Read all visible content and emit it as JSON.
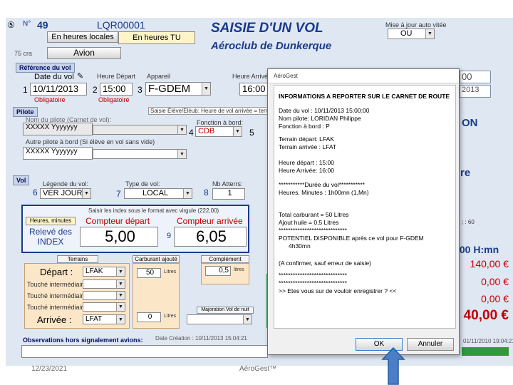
{
  "header": {
    "corner_glyph": "⑤",
    "num_label": "N°",
    "num_value": "49",
    "record_code": "LQR00001",
    "title": "SAISIE D'UN VOL",
    "subtitle": "Aéroclub de Dunkerque",
    "btn_heures_locales": "En heures locales",
    "btn_heures_tu": "En heures TU",
    "btn_avion": "Avion",
    "side_text": "75 cra",
    "mise_label": "Mise à jour auto vitée",
    "mise_value": "OU"
  },
  "reference": {
    "section": "Référence du vol",
    "date_label": "Date du vol",
    "date_value": "10/11/2013",
    "date_sub": "Obligatoire",
    "heure_label": "Heure Départ",
    "heure_value": "15:00",
    "heure_sub": "Obligatoire",
    "appareil_label": "Appareil",
    "appareil_value": "F-GDEM",
    "arrivee_label": "Heure Arrivée",
    "arrivee_value": "16:00",
    "num1": "1",
    "num2": "2",
    "num3": "3",
    "right_box1": "00",
    "right_box2": "2013"
  },
  "pilote": {
    "section": "Pilote",
    "saisie_note": "Saisie Élève/Elèub: Heure de vol arrivée = temps",
    "nom_label": "Nom du pilote (Carnet de vol):",
    "nom_value": "XXXXX Yyyyyyy",
    "fonction_label": "Fonction à bord:",
    "fonction_value": "CDB",
    "num4": "4",
    "num5": "5",
    "instr_label": "Autre pilote à bord (Si élève en vol sans vide)",
    "instr_value": "XXXXX Yyyyyyy",
    "right_on": "ON",
    "right_re": "re"
  },
  "vol": {
    "section": "Vol",
    "legende_label": "Légende du vol:",
    "legende_value": "VER JOUR",
    "type_label": "Type de vol:",
    "type_value": "LOCAL",
    "att_label": "Nb Atterrs:",
    "att_value": "1",
    "num6": "6",
    "num7": "7",
    "num8": "8",
    "right_60": "; : 60"
  },
  "compteurs": {
    "instruction": "Saisir les index sous le format avec virgule (222,00)",
    "heures_btn": "Heures, minutes",
    "depart_label": "Compteur départ",
    "arrivee_label": "Compteur arrivée",
    "releve": "Relevé des INDEX",
    "depart_value": "5,00",
    "arrivee_value": "6,05",
    "num9": "9",
    "right_hmm": ",00 H:mn"
  },
  "terrains": {
    "terrains_label": "Terrains",
    "carburant_label": "Carburant ajouté",
    "complement_label": "Complément d'huile",
    "depart_label": "Départ :",
    "depart_value": "LFAK",
    "t1_label": "Touché intermédiaire:",
    "t2_label": "Touché intermédiaire:",
    "t3_label": "Touché intermédiaire:",
    "arrivee_label": "Arrivée :",
    "arrivee_value": "LFAT",
    "carb_value": "50",
    "carb_unit": "Litres",
    "huile_value": "0,5",
    "huile_unit": "litres",
    "zero_value": "0",
    "zero_unit": "Litres",
    "majoration_label": "Majoration Vol de nuit",
    "price1": "140,00 €",
    "price2": "0,00 €",
    "price3": "0,00 €",
    "price_total": "40,00 €"
  },
  "footer": {
    "obs_label": "Observations hors signalement avions:",
    "date_creation": "Date Création :  10/11/2013 15:04:21",
    "right_date": "01/11/2010 19:04:21",
    "date": "12/23/2021",
    "brand": "AéroGest™"
  },
  "dialog": {
    "title": "AéroGest",
    "heading": "INFORMATIONS A REPORTER SUR LE CARNET DE ROUTE",
    "lines_a": [
      "Date du vol : 10/11/2013 15:00:00",
      "Nom pilote: LORIDAN Philippe",
      "Fonction à bord : P"
    ],
    "lines_b": [
      "Terrain départ: LFAK",
      "Terrain arrivée : LFAT"
    ],
    "lines_c": [
      "Heure départ : 15:00",
      "Heure Arrivée: 16:00"
    ],
    "lines_d": [
      "***********Durée du vol***********",
      "Heures, Minutes : 1h00mn (1,Mn)"
    ],
    "lines_e": [
      "Total carburant = 50 Litres",
      "Ajout huile = 0,5 Litres",
      "*****************************",
      "POTENTIEL DISPONIBLE après ce vol pour F-GDEM",
      "4h30mn"
    ],
    "lines_f": [
      "(A confirmer, sauf erreur de saisie)",
      "*****************************",
      "*****************************",
      ">> Etes vous sur de vouloir enregistrer ? <<"
    ],
    "ok": "OK",
    "cancel": "Annuler"
  },
  "colors": {
    "form_bg": "#dfe7f3",
    "accent_blue": "#1a3a8a",
    "red": "#c00000",
    "arrow_blue": "#4a7fc8",
    "green_cell": "#2e9a3a"
  }
}
